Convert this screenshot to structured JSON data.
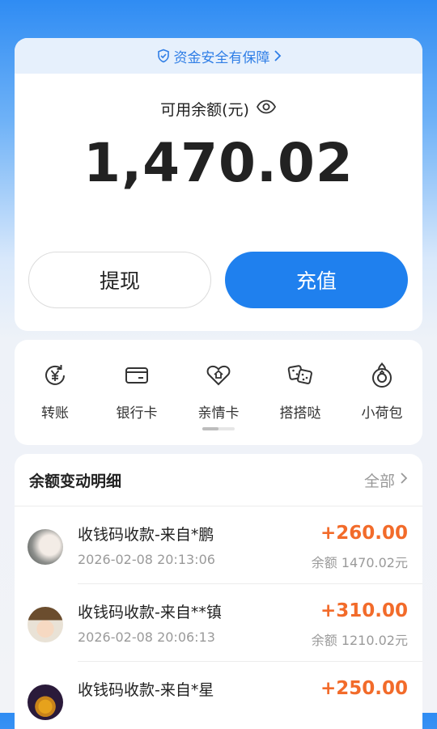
{
  "balance_card": {
    "safety_text": "资金安全有保障",
    "label": "可用余额(元)",
    "amount": "1,470.02",
    "withdraw_label": "提现",
    "recharge_label": "充值"
  },
  "actions": [
    {
      "label": "转账",
      "icon": "transfer-yen-icon"
    },
    {
      "label": "银行卡",
      "icon": "bank-card-icon"
    },
    {
      "label": "亲情卡",
      "icon": "family-card-icon"
    },
    {
      "label": "搭搭哒",
      "icon": "dice-icon"
    },
    {
      "label": "小荷包",
      "icon": "purse-icon"
    }
  ],
  "transactions": {
    "title": "余额变动明细",
    "all_label": "全部",
    "items": [
      {
        "name": "收钱码收款-来自*鹏",
        "time": "2026-02-08 20:13:06",
        "amount": "+260.00",
        "balance": "余额 1470.02元"
      },
      {
        "name": "收钱码收款-来自**镇",
        "time": "2026-02-08 20:06:13",
        "amount": "+310.00",
        "balance": "余额 1210.02元"
      },
      {
        "name": "收钱码收款-来自*星",
        "time": "",
        "amount": "+250.00",
        "balance": ""
      }
    ]
  },
  "colors": {
    "accent": "#1f80ee",
    "income": "#f26b2a",
    "safety_text": "#2f7ee6"
  }
}
